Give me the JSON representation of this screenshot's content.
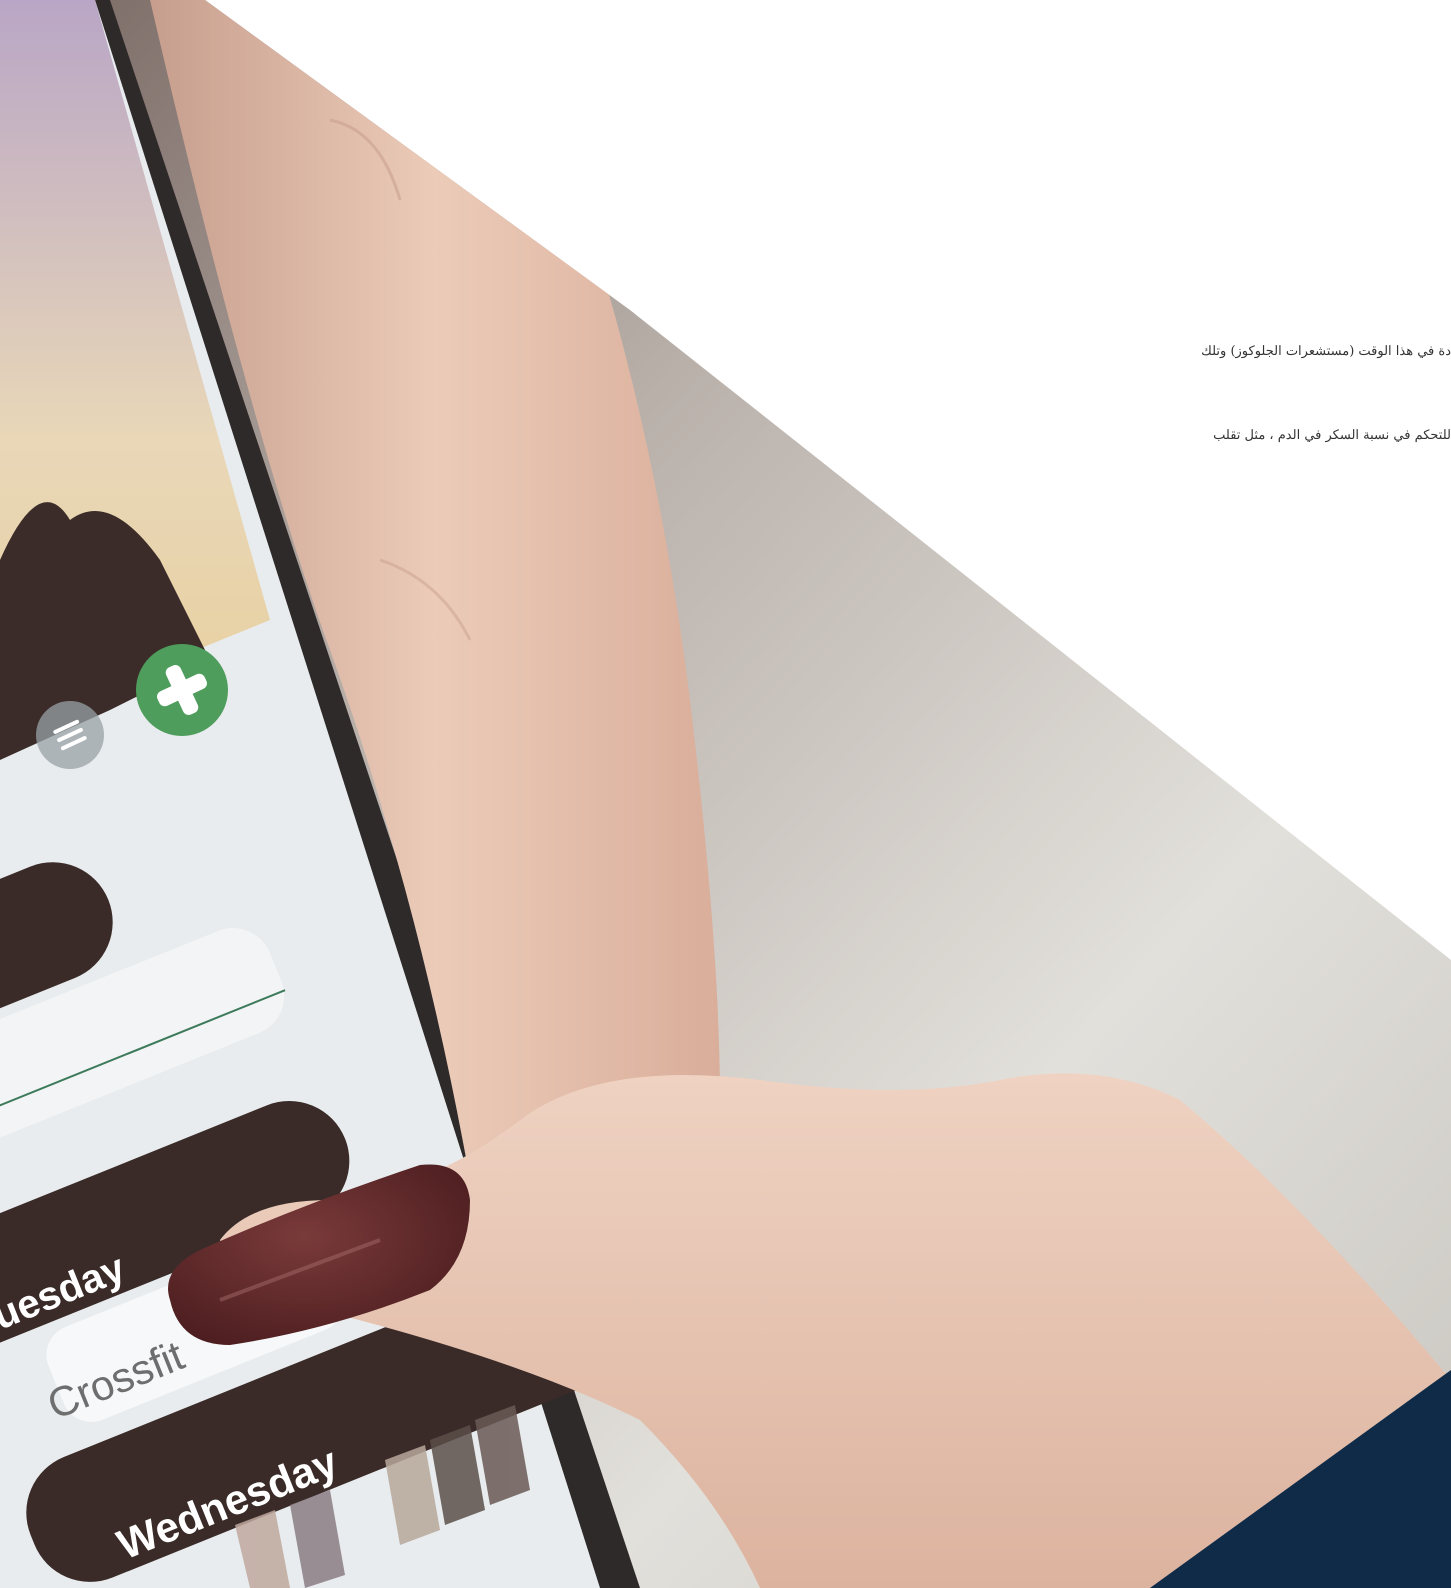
{
  "paragraph": {
    "line_1": "دة في هذا الوقت (مستشعرات الجلوكوز) وتلك",
    "line_2": "للتحكم في نسبة السكر في الدم ، مثل تقلب"
  },
  "phone_ui": {
    "day_label_1": "uesday",
    "card_label": "Crossfit",
    "day_label_2": "Wednesday",
    "menu_icon": "hamburger-menu-icon",
    "add_icon": "plus-icon"
  },
  "colors": {
    "accent_green": "#4e9d5c",
    "card_brown": "#3a2b28",
    "navy_corner": "#0f2b48",
    "nail": "#5a2426",
    "skin": "#e9c6b4",
    "background_grey": "#cfccc6"
  }
}
